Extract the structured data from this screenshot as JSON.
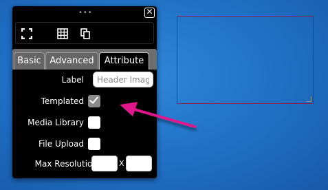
{
  "panel": {
    "grip": "•••",
    "close": "✕",
    "toolbar": [
      {
        "icon": "fullscreen-icon"
      },
      {
        "icon": "grid-icon"
      },
      {
        "icon": "copy-icon"
      }
    ],
    "tabs": [
      {
        "label": "Basic",
        "active": false
      },
      {
        "label": "Advanced",
        "active": false
      },
      {
        "label": "Attribute",
        "active": true
      }
    ]
  },
  "form": {
    "label": {
      "label": "Label",
      "placeholder": "Header Imag"
    },
    "templated": {
      "label": "Templated",
      "checked": true
    },
    "media_library": {
      "label": "Media Library",
      "checked": false
    },
    "file_upload": {
      "label": "File Upload",
      "checked": false
    },
    "max_resolution": {
      "label": "Max Resolution",
      "width": "",
      "height": "",
      "separator": "X"
    }
  },
  "colors": {
    "canvas_border": "#8b1e4a",
    "arrow": "#e0198a",
    "background": "#1f6fc4"
  }
}
